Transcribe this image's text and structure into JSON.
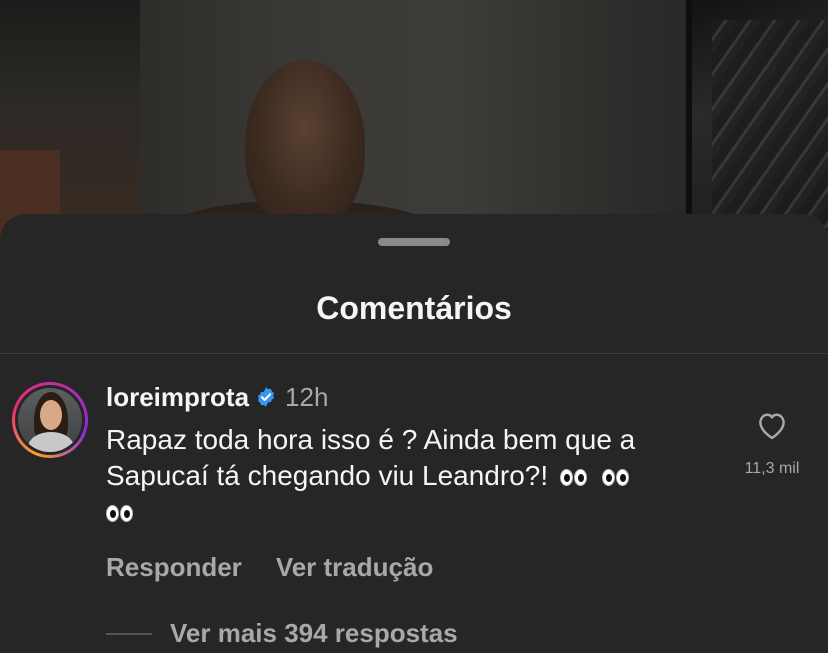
{
  "sheet": {
    "title": "Comentários"
  },
  "comment": {
    "username": "loreimprota",
    "verified": true,
    "time": "12h",
    "text": "Rapaz toda hora isso é ? Ainda bem que a Sapucaí tá chegando viu Leandro?!",
    "emoji": "👀👀👀",
    "likes": "11,3 mil",
    "reply_label": "Responder",
    "translate_label": "Ver tradução",
    "more_replies_label": "Ver mais 394 respostas"
  },
  "colors": {
    "sheet_bg": "#262626",
    "verified_blue": "#3897f0",
    "secondary_text": "#a8a8a8"
  }
}
